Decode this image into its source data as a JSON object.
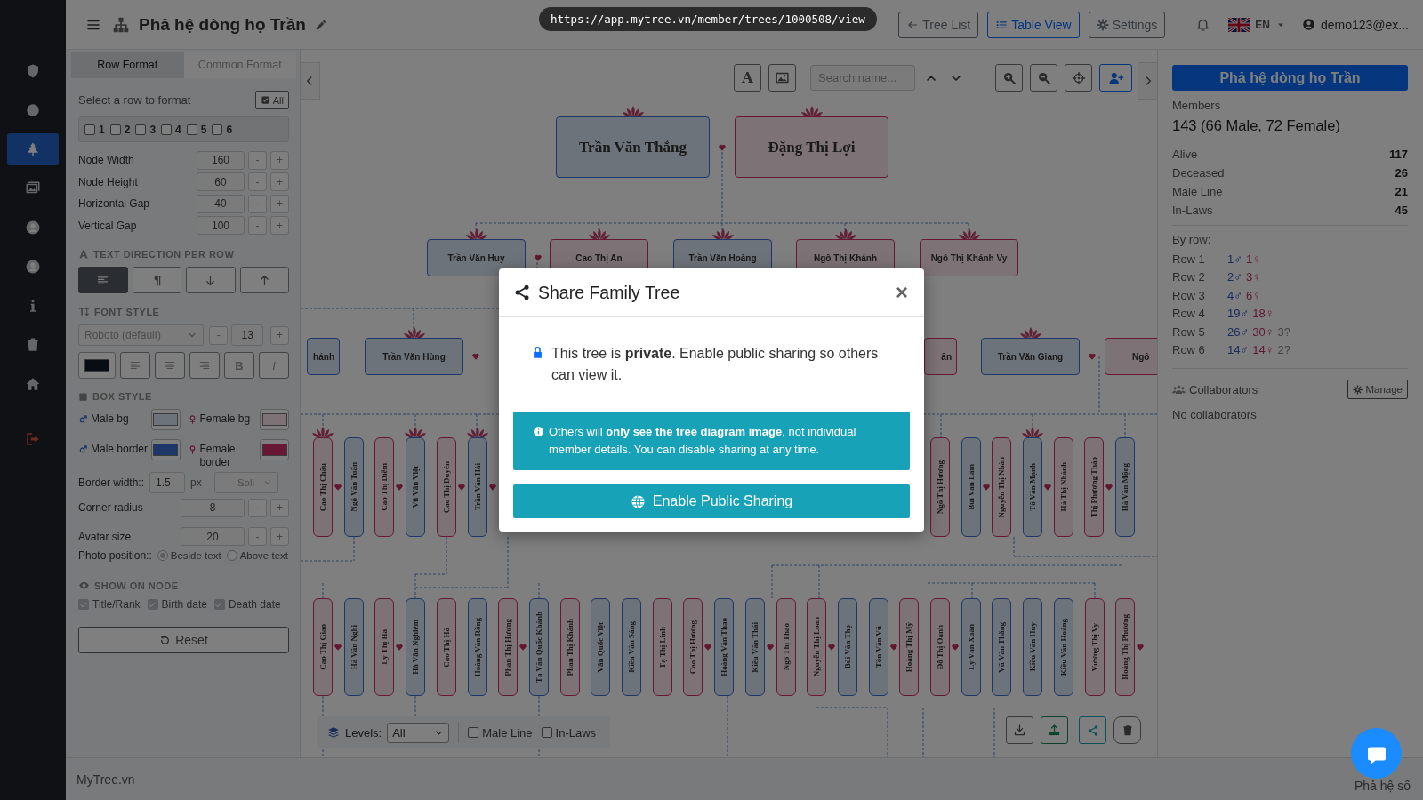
{
  "topbar": {
    "title": "Phả hệ dòng họ Trần",
    "url": "https://app.mytree.vn/member/trees/1000508/view",
    "buttons": [
      {
        "label": "Tree List",
        "selected": false
      },
      {
        "label": "Table View",
        "selected": true
      },
      {
        "label": "Settings",
        "selected": false
      }
    ],
    "language": "EN",
    "user": "demo123@ex..."
  },
  "sidebar": {
    "items": [
      {
        "selected": false
      },
      {
        "selected": false
      },
      {
        "selected": true
      },
      {
        "selected": false
      },
      {
        "selected": false
      },
      {
        "selected": false
      },
      {
        "selected": false
      },
      {
        "selected": false
      },
      {
        "selected": false
      },
      {
        "selected": false
      }
    ]
  },
  "left_panel": {
    "tabs": [
      {
        "label": "Row Format",
        "selected": true
      },
      {
        "label": "Common Format",
        "selected": false
      }
    ],
    "select_label": "Select a row to format",
    "all_button": "All",
    "rows": [
      {
        "label": "1",
        "checked": false
      },
      {
        "label": "2",
        "checked": false
      },
      {
        "label": "3",
        "checked": false
      },
      {
        "label": "4",
        "checked": false
      },
      {
        "label": "5",
        "checked": false
      },
      {
        "label": "6",
        "checked": false
      }
    ],
    "sizes": [
      {
        "label": "Node Width",
        "value": "160",
        "minus": "-",
        "plus": "+"
      },
      {
        "label": "Node Height",
        "value": "60",
        "minus": "-",
        "plus": "+"
      },
      {
        "label": "Horizontal Gap",
        "value": "40",
        "minus": "-",
        "plus": "+"
      },
      {
        "label": "Vertical Gap",
        "value": "100",
        "minus": "-",
        "plus": "+"
      }
    ],
    "text_direction": {
      "title": "TEXT DIRECTION PER ROW",
      "options": [
        {
          "selected": true
        },
        {
          "selected": false
        },
        {
          "selected": false
        },
        {
          "selected": false
        }
      ]
    },
    "font_style": {
      "title": "FONT STYLE",
      "font": "Roboto (default)",
      "minus": "-",
      "size": "13",
      "plus": "+",
      "bold": "B",
      "italic": "I"
    },
    "box_style": {
      "title": "BOX STYLE",
      "colors": [
        {
          "label": "Male bg",
          "kind": "male",
          "color": "#6d737a"
        },
        {
          "label": "Female bg",
          "kind": "female",
          "color": "#7d7275"
        },
        {
          "label": "Male border",
          "kind": "male",
          "color": "#1d3768"
        },
        {
          "label": "Female border",
          "kind": "female",
          "color": "#681835"
        }
      ],
      "border_width": {
        "label": "Border width::",
        "value": "1.5",
        "unit": "px",
        "style": "– – Soli"
      },
      "corner_radius": {
        "label": "Corner radius",
        "value": "8",
        "minus": "-",
        "plus": "+"
      },
      "avatar_size": {
        "label": "Avatar size",
        "value": "20",
        "minus": "-",
        "plus": "+"
      },
      "photo_position": {
        "label": "Photo position::",
        "options": [
          {
            "label": "Beside text",
            "selected": true
          },
          {
            "label": "Above text",
            "selected": false
          }
        ]
      }
    },
    "show_on_node": {
      "title": "SHOW ON NODE",
      "items": [
        {
          "label": "Title/Rank",
          "checked": true
        },
        {
          "label": "Birth date",
          "checked": true
        },
        {
          "label": "Death date",
          "checked": true
        }
      ]
    },
    "reset": "Reset"
  },
  "canvas": {
    "font_button": "A",
    "search": {
      "placeholder": "Search name..."
    },
    "tree": {
      "rows": [
        {
          "nodes": [
            {
              "name": "Trần Văn Thắng",
              "kind": "male",
              "lotus": true,
              "heart": true
            },
            {
              "name": "Đặng Thị Lợi",
              "kind": "female",
              "lotus": true,
              "heart": false
            }
          ]
        },
        {
          "nodes": [
            {
              "name": "Trần Văn Huy",
              "kind": "male",
              "lotus": true,
              "heart": true
            },
            {
              "name": "Cao Thị An",
              "kind": "female",
              "lotus": true,
              "heart": false
            },
            {
              "name": "Trần Văn Hoàng",
              "kind": "male",
              "lotus": true,
              "heart": false
            },
            {
              "name": "Ngô Thị Khánh",
              "kind": "female",
              "lotus": true,
              "heart": false
            },
            {
              "name": "Ngô Thị Khánh Vy",
              "kind": "female",
              "lotus": true,
              "heart": false
            }
          ]
        },
        {
          "nodes": [
            {
              "name": "hánh",
              "kind": "male",
              "lotus": false,
              "heart": false
            },
            {
              "name": "Trần Văn Hùng",
              "kind": "male",
              "lotus": true,
              "heart": true
            },
            {
              "name": "ân",
              "kind": "female",
              "lotus": false,
              "heart": false
            },
            {
              "name": "Trần Văn Giang",
              "kind": "male",
              "lotus": true,
              "heart": true
            },
            {
              "name": "Ngô",
              "kind": "female",
              "lotus": false,
              "heart": false
            }
          ]
        },
        {
          "nodes": [
            {
              "name": "Cao Thị Châu",
              "kind": "female",
              "lotus": true,
              "heart": true
            },
            {
              "name": "Ngô Văn Tuấn",
              "kind": "male",
              "lotus": false,
              "heart": false
            },
            {
              "name": "Cao Thị Diễm",
              "kind": "female",
              "lotus": false,
              "heart": true
            },
            {
              "name": "Vũ Văn Việt",
              "kind": "male",
              "lotus": true,
              "heart": false
            },
            {
              "name": "Cao Thị Duyên",
              "kind": "female",
              "lotus": false,
              "heart": true
            },
            {
              "name": "Trần Văn Hải",
              "kind": "male",
              "lotus": true,
              "heart": true
            },
            {
              "name": "Ngô Thị Hương",
              "kind": "female",
              "lotus": false,
              "heart": false
            },
            {
              "name": "Bùi Văn Lâm",
              "kind": "male",
              "lotus": false,
              "heart": true
            },
            {
              "name": "Nguyễn Thị Nhàn",
              "kind": "female",
              "lotus": false,
              "heart": false
            },
            {
              "name": "Tô Văn Mạnh",
              "kind": "male",
              "lotus": true,
              "heart": true
            },
            {
              "name": "Hà Thị Nhành",
              "kind": "female",
              "lotus": false,
              "heart": false
            },
            {
              "name": "Thị Phương Thảo",
              "kind": "female",
              "lotus": false,
              "heart": true
            },
            {
              "name": "Hà Văn Mộng",
              "kind": "male",
              "lotus": false,
              "heart": false
            }
          ]
        },
        {
          "nodes": [
            {
              "name": "Cao Thị Giao",
              "kind": "female",
              "lotus": false,
              "heart": true
            },
            {
              "name": "Hà Văn Nghị",
              "kind": "male",
              "lotus": false,
              "heart": false
            },
            {
              "name": "Lý Thị Hà",
              "kind": "female",
              "lotus": false,
              "heart": true
            },
            {
              "name": "Hà Văn Nghiêm",
              "kind": "male",
              "lotus": false,
              "heart": false
            },
            {
              "name": "Cao Thị Hà",
              "kind": "female",
              "lotus": false,
              "heart": false
            },
            {
              "name": "Hoàng Văn Rồng",
              "kind": "male",
              "lotus": false,
              "heart": false
            },
            {
              "name": "Phan Thị Hương",
              "kind": "female",
              "lotus": false,
              "heart": true
            },
            {
              "name": "Tạ Văn Quốc Khánh",
              "kind": "male",
              "lotus": false,
              "heart": false
            },
            {
              "name": "Phan Thị Khánh",
              "kind": "female",
              "lotus": false,
              "heart": false
            },
            {
              "name": "Văn Quốc Việt",
              "kind": "male",
              "lotus": false,
              "heart": false
            },
            {
              "name": "Kiều Văn Sáng",
              "kind": "male",
              "lotus": false,
              "heart": false
            },
            {
              "name": "Tạ Thị Linh",
              "kind": "female",
              "lotus": false,
              "heart": false
            },
            {
              "name": "Cao Thị Hương",
              "kind": "female",
              "lotus": false,
              "heart": true
            },
            {
              "name": "Hoàng Văn Thạo",
              "kind": "male",
              "lotus": false,
              "heart": false
            },
            {
              "name": "Kiều Văn Thái",
              "kind": "male",
              "lotus": false,
              "heart": true
            },
            {
              "name": "Ngô Thị Thảo",
              "kind": "female",
              "lotus": false,
              "heart": false
            },
            {
              "name": "Nguyễn Thị Loan",
              "kind": "female",
              "lotus": false,
              "heart": true
            },
            {
              "name": "Bùi Văn Thọ",
              "kind": "male",
              "lotus": false,
              "heart": false
            },
            {
              "name": "Tôn Văn Vũ",
              "kind": "male",
              "lotus": false,
              "heart": true
            },
            {
              "name": "Hoàng Thị Mỹ",
              "kind": "female",
              "lotus": false,
              "heart": false
            },
            {
              "name": "Đỗ Thị Oanh",
              "kind": "female",
              "lotus": false,
              "heart": true
            },
            {
              "name": "Lý Văn Xuân",
              "kind": "male",
              "lotus": false,
              "heart": false
            },
            {
              "name": "Vũ Văn Thắng",
              "kind": "male",
              "lotus": false,
              "heart": false
            },
            {
              "name": "Kiều Văn Huy",
              "kind": "male",
              "lotus": false,
              "heart": false
            },
            {
              "name": "Kiều Văn Hoàng",
              "kind": "male",
              "lotus": false,
              "heart": false
            },
            {
              "name": "Vương Thị Vy",
              "kind": "female",
              "lotus": false,
              "heart": false
            },
            {
              "name": "Hoàng Thị Phương",
              "kind": "female",
              "lotus": false,
              "heart": true
            }
          ]
        }
      ]
    },
    "levels": {
      "label": "Levels:",
      "value": "All"
    },
    "filters": [
      {
        "label": "Male Line",
        "checked": false
      },
      {
        "label": "In-Laws",
        "checked": false
      }
    ]
  },
  "right_panel": {
    "title": "Phả hệ dòng họ Trần",
    "members_label": "Members",
    "members": "143 (66 Male, 72 Female)",
    "stats": [
      {
        "label": "Alive",
        "value": "117"
      },
      {
        "label": "Deceased",
        "value": "26"
      },
      {
        "label": "Male Line",
        "value": "21"
      },
      {
        "label": "In-Laws",
        "value": "45"
      }
    ],
    "by_row_label": "By row:",
    "by_row": [
      {
        "label": "Row 1",
        "male": "1♂",
        "female": "1♀"
      },
      {
        "label": "Row 2",
        "male": "2♂",
        "female": "3♀"
      },
      {
        "label": "Row 3",
        "male": "4♂",
        "female": "6♀"
      },
      {
        "label": "Row 4",
        "male": "19♂",
        "female": "18♀"
      },
      {
        "label": "Row 5",
        "male": "26♂",
        "female": "30♀",
        "unknown": "3?"
      },
      {
        "label": "Row 6",
        "male": "14♂",
        "female": "14♀",
        "unknown": "2?"
      }
    ],
    "collaborators_label": "Collaborators",
    "manage": "Manage",
    "collaborators_empty": "No collaborators"
  },
  "modal": {
    "title": "Share Family Tree",
    "close": "×",
    "message": "This tree is **private**. Enable public sharing so others can view it.",
    "info": "Others will **only see the tree diagram image**, not individual member details. You can disable sharing at any time.",
    "button": "Enable Public Sharing"
  },
  "footer": {
    "left": "MyTree.vn",
    "right": "Phả hệ số"
  }
}
